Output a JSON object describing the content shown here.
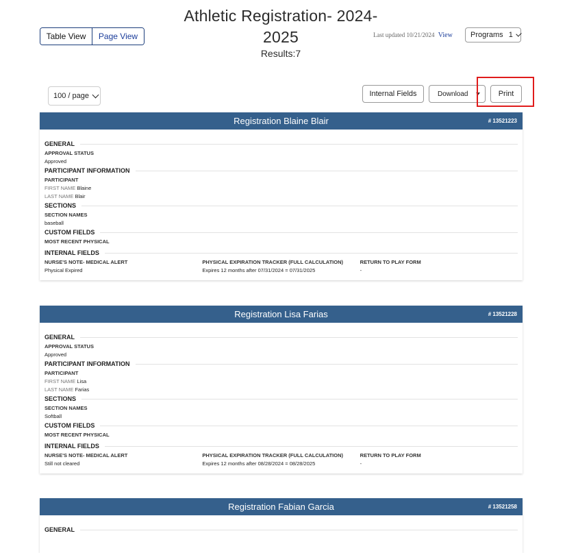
{
  "header": {
    "title": "Athletic Registration- 2024-2025",
    "results": "Results:7",
    "view_toggle": {
      "table": "Table View",
      "page": "Page View"
    },
    "last_updated": "Last updated 10/21/2024",
    "view_link": "View",
    "programs_label": "Programs",
    "programs_count": "1"
  },
  "toolbar": {
    "per_page": "100 / page",
    "internal_fields": "Internal Fields",
    "download": "Download",
    "print": "Print"
  },
  "labels": {
    "general": "GENERAL",
    "approval_status": "APPROVAL STATUS",
    "participant_info": "PARTICIPANT INFORMATION",
    "participant": "PARTICIPANT",
    "first_name": "FIRST NAME",
    "last_name": "LAST NAME",
    "sections": "SECTIONS",
    "section_names": "SECTION NAMES",
    "custom_fields": "CUSTOM FIELDS",
    "most_recent_physical": "MOST RECENT PHYSICAL",
    "internal_fields": "INTERNAL FIELDS",
    "nurse_note": "NURSE'S NOTE- MEDICAL ALERT",
    "physical_tracker": "PHYSICAL EXPIRATION TRACKER (FULL CALCULATION)",
    "return_to_play": "RETURN TO PLAY FORM"
  },
  "records": [
    {
      "title": "Registration Blaine Blair",
      "number": "# 13521223",
      "approval": "Approved",
      "first_name": "Blaine",
      "last_name": "Blair",
      "section": "baseball",
      "nurse_note": "Physical Expired",
      "tracker": "Expires 12 months after 07/31/2024 = 07/31/2025",
      "return_to_play": "-"
    },
    {
      "title": "Registration Lisa Farias",
      "number": "# 13521228",
      "approval": "Approved",
      "first_name": "Lisa",
      "last_name": "Farias",
      "section": "Softball",
      "nurse_note": "Still not cleared",
      "tracker": "Expires 12 months after 08/28/2024 = 08/28/2025",
      "return_to_play": "-"
    },
    {
      "title": "Registration Fabian Garcia",
      "number": "# 13521258"
    }
  ]
}
